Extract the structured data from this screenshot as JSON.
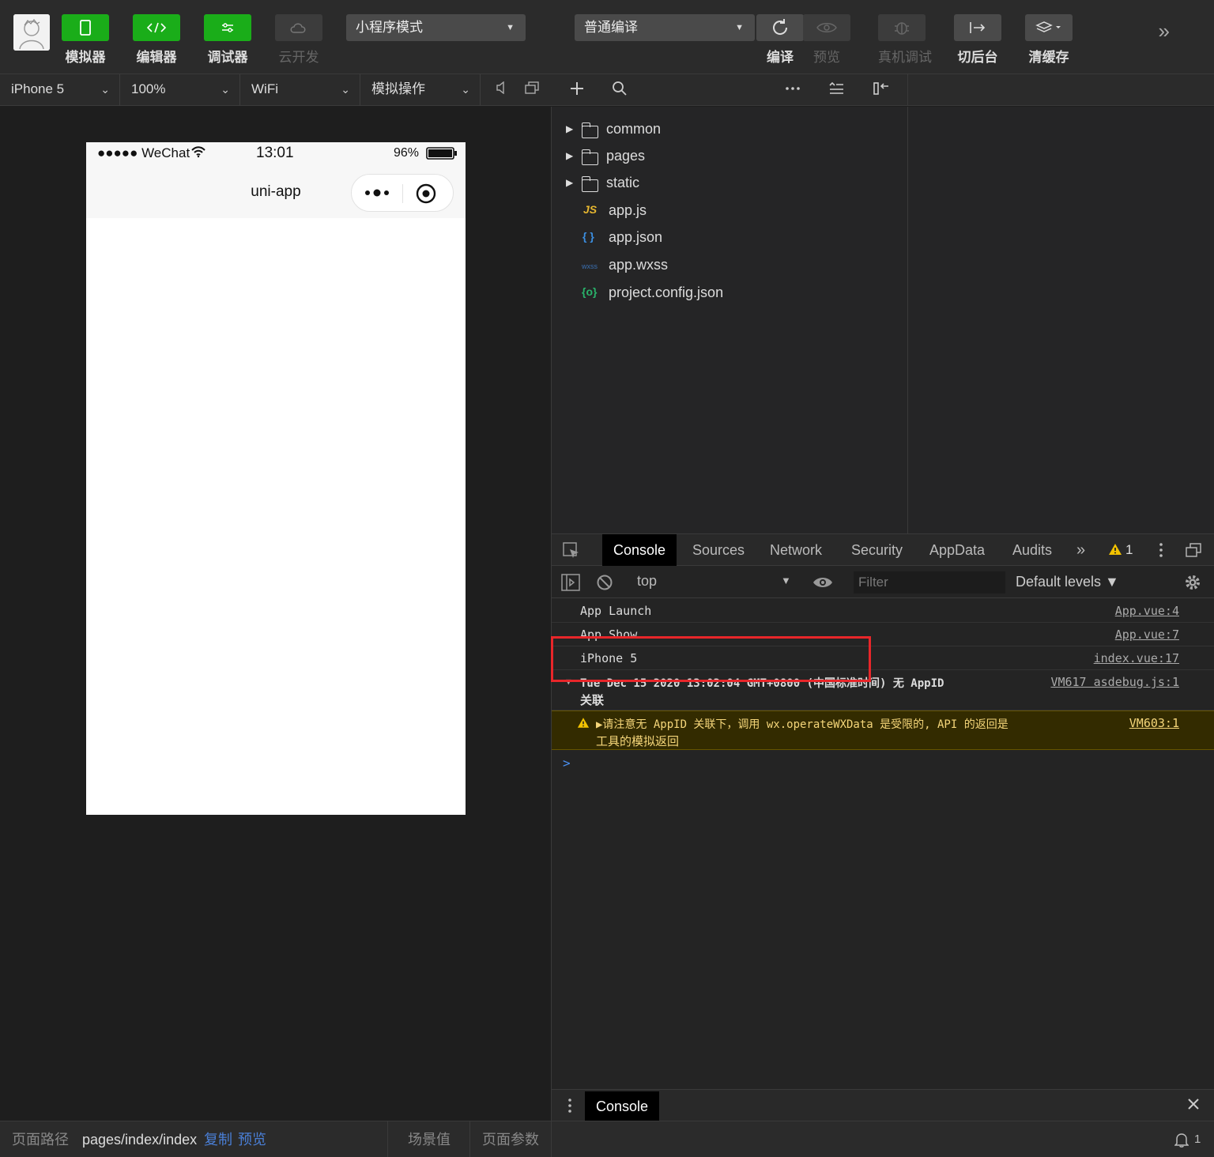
{
  "toolbar": {
    "simulator_label": "模拟器",
    "editor_label": "编辑器",
    "debugger_label": "调试器",
    "cloud_label": "云开发",
    "mode_select": "小程序模式",
    "compile_select": "普通编译",
    "compile_label": "编译",
    "preview_label": "预览",
    "remote_debug_label": "真机调试",
    "background_label": "切后台",
    "clear_cache_label": "清缓存"
  },
  "simbar": {
    "device": "iPhone 5",
    "zoom": "100%",
    "network": "WiFi",
    "ops": "模拟操作"
  },
  "phone": {
    "signal": "●●●●● WeChat",
    "time": "13:01",
    "battery": "96%",
    "title": "uni-app"
  },
  "explorer": {
    "items": [
      {
        "type": "folder",
        "name": "common"
      },
      {
        "type": "folder",
        "name": "pages"
      },
      {
        "type": "folder",
        "name": "static"
      },
      {
        "type": "js",
        "icon": "JS",
        "name": "app.js"
      },
      {
        "type": "json",
        "icon": "{ }",
        "name": "app.json"
      },
      {
        "type": "wxss",
        "icon": "wxss",
        "name": "app.wxss"
      },
      {
        "type": "config",
        "icon": "{o}",
        "name": "project.config.json"
      }
    ]
  },
  "devtools": {
    "tabs": [
      "Console",
      "Sources",
      "Network",
      "Security",
      "AppData",
      "Audits"
    ],
    "more": "»",
    "warn_count": "1",
    "context": "top",
    "filter_placeholder": "Filter",
    "levels": "Default levels ▼",
    "logs": [
      {
        "msg": "App Launch",
        "src": "App.vue:4"
      },
      {
        "msg": "App Show",
        "src": "App.vue:7"
      },
      {
        "msg": "iPhone 5",
        "src": "index.vue:17"
      },
      {
        "msg": "Tue Dec 15 2020 13:02:04 GMT+0800 (中国标准时间) 无 AppID",
        "msg2": "关联",
        "src": "VM617 asdebug.js:1"
      },
      {
        "msg": "▶请注意无 AppID 关联下，调用 wx.operateWXData 是受限的, API 的返回是",
        "msg2": "工具的模拟返回",
        "src": "VM603:1"
      }
    ],
    "prompt": ">",
    "drawer_tab": "Console"
  },
  "bottom": {
    "path_label": "页面路径",
    "path": "pages/index/index",
    "copy": "复制",
    "preview": "预览",
    "scene": "场景值",
    "params": "页面参数",
    "notif_count": "1"
  },
  "colors": {
    "accent_green": "#1aad19",
    "highlight_red": "#e8262a",
    "warn_bg": "#332b00",
    "warn_text": "#f5d67a",
    "link_blue": "#4a7fd6"
  }
}
